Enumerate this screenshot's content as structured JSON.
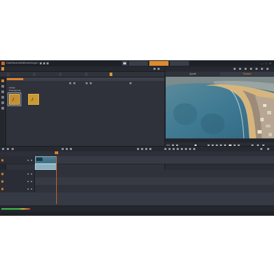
{
  "app": {
    "menu": [
      "Datei",
      "Bearbeiten",
      "Einstellungen"
    ],
    "mode_tabs": [
      {
        "label": "",
        "active": false
      },
      {
        "label": "",
        "active": true
      },
      {
        "label": "",
        "active": false
      }
    ],
    "window_controls": [
      "—",
      "□",
      "✕"
    ]
  },
  "library": {
    "top_tabs": [
      "",
      "",
      "",
      ""
    ],
    "category_tabs": [
      {
        "label": "",
        "active": false
      },
      {
        "label": "",
        "active": false
      },
      {
        "label": "",
        "active": false
      },
      {
        "label": "",
        "active": false
      },
      {
        "label": "",
        "active": true
      }
    ],
    "breadcrumb": "",
    "tree": [
      "Ordner",
      "Hintergründe"
    ],
    "path": "",
    "info_line_1": "",
    "info_line_2": "",
    "items": [
      {
        "caption": "",
        "selected": true
      },
      {
        "caption": "",
        "selected": false
      }
    ],
    "footer_label": ""
  },
  "player": {
    "tabs": [
      {
        "label": "Quelle",
        "active": false
      },
      {
        "label": "Timeline",
        "active": true
      }
    ],
    "volume": 0.55,
    "scrub_times": [
      "",
      "",
      "",
      "",
      ""
    ]
  },
  "timeline": {
    "tracks": [
      {
        "label": ""
      },
      {
        "label": ""
      },
      {
        "label": ""
      },
      {
        "label": ""
      }
    ],
    "ruler": [
      "",
      "",
      "",
      "",
      "",
      "",
      "",
      "",
      "",
      "",
      ""
    ]
  },
  "colors": {
    "accent": "#e08a2e",
    "panel": "#2b2e36",
    "clip": "#507e92"
  }
}
